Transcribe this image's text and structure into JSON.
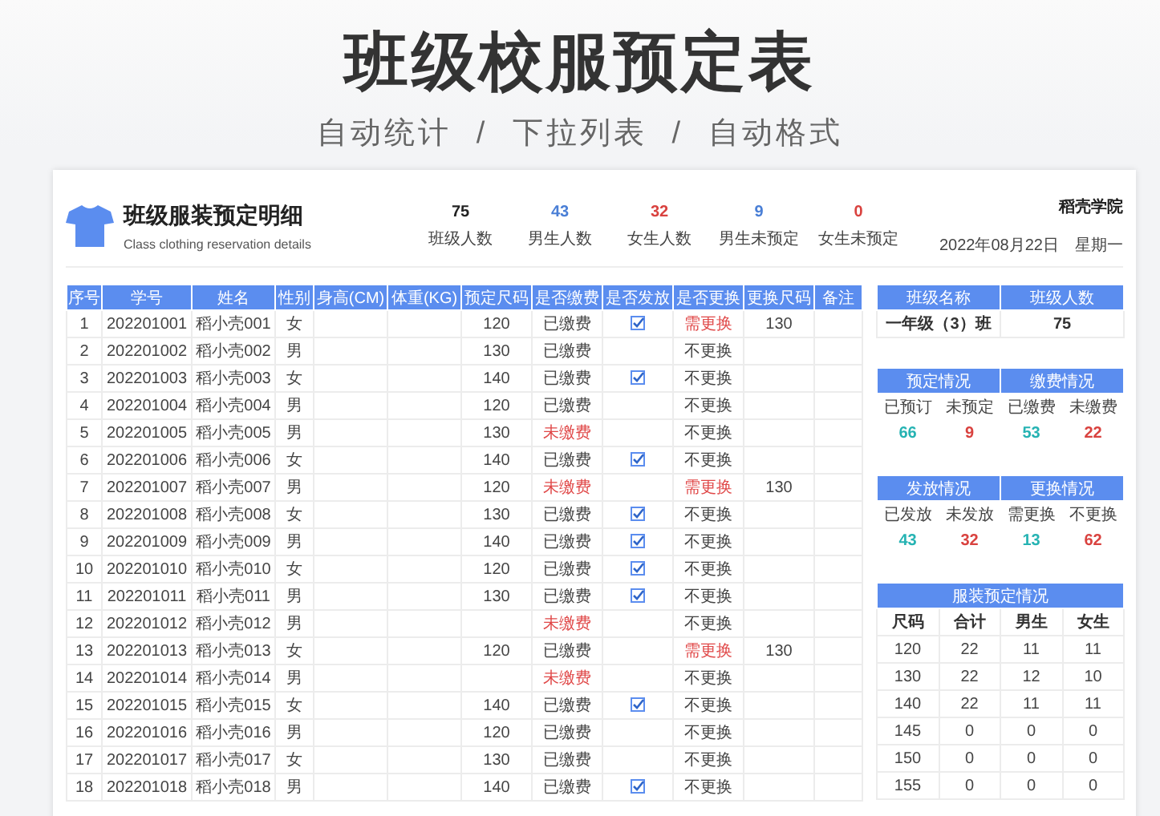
{
  "title": "班级校服预定表",
  "subtitle": "自动统计 / 下拉列表 / 自动格式",
  "card": {
    "title": "班级服装预定明细",
    "subtitle": "Class clothing reservation details",
    "school": "稻壳学院",
    "date": "2022年08月22日",
    "weekday": "星期一",
    "stats": [
      {
        "value": "75",
        "label": "班级人数",
        "color": "#222222"
      },
      {
        "value": "43",
        "label": "男生人数",
        "color": "#4a7fd6"
      },
      {
        "value": "32",
        "label": "女生人数",
        "color": "#d9423f"
      },
      {
        "value": "9",
        "label": "男生未预定",
        "color": "#4a7fd6"
      },
      {
        "value": "0",
        "label": "女生未预定",
        "color": "#d9423f"
      }
    ]
  },
  "table": {
    "columns": [
      "序号",
      "学号",
      "姓名",
      "性别",
      "身高(CM)",
      "体重(KG)",
      "预定尺码",
      "是否缴费",
      "是否发放",
      "是否更换",
      "更换尺码",
      "备注"
    ],
    "rows": [
      {
        "no": "1",
        "id": "202201001",
        "name": "稻小壳001",
        "gender": "女",
        "size": "120",
        "payment": "已缴费",
        "paid": true,
        "delivered": true,
        "exchange": "需更换",
        "exchange_needed": true,
        "new_size": "130"
      },
      {
        "no": "2",
        "id": "202201002",
        "name": "稻小壳002",
        "gender": "男",
        "size": "130",
        "payment": "已缴费",
        "paid": true,
        "delivered": false,
        "exchange": "不更换",
        "exchange_needed": false
      },
      {
        "no": "3",
        "id": "202201003",
        "name": "稻小壳003",
        "gender": "女",
        "size": "140",
        "payment": "已缴费",
        "paid": true,
        "delivered": true,
        "exchange": "不更换",
        "exchange_needed": false
      },
      {
        "no": "4",
        "id": "202201004",
        "name": "稻小壳004",
        "gender": "男",
        "size": "120",
        "payment": "已缴费",
        "paid": true,
        "delivered": false,
        "exchange": "不更换",
        "exchange_needed": false
      },
      {
        "no": "5",
        "id": "202201005",
        "name": "稻小壳005",
        "gender": "男",
        "size": "130",
        "payment": "未缴费",
        "paid": false,
        "delivered": false,
        "exchange": "不更换",
        "exchange_needed": false
      },
      {
        "no": "6",
        "id": "202201006",
        "name": "稻小壳006",
        "gender": "女",
        "size": "140",
        "payment": "已缴费",
        "paid": true,
        "delivered": true,
        "exchange": "不更换",
        "exchange_needed": false
      },
      {
        "no": "7",
        "id": "202201007",
        "name": "稻小壳007",
        "gender": "男",
        "size": "120",
        "payment": "未缴费",
        "paid": false,
        "delivered": false,
        "exchange": "需更换",
        "exchange_needed": true,
        "new_size": "130"
      },
      {
        "no": "8",
        "id": "202201008",
        "name": "稻小壳008",
        "gender": "女",
        "size": "130",
        "payment": "已缴费",
        "paid": true,
        "delivered": true,
        "exchange": "不更换",
        "exchange_needed": false
      },
      {
        "no": "9",
        "id": "202201009",
        "name": "稻小壳009",
        "gender": "男",
        "size": "140",
        "payment": "已缴费",
        "paid": true,
        "delivered": true,
        "exchange": "不更换",
        "exchange_needed": false
      },
      {
        "no": "10",
        "id": "202201010",
        "name": "稻小壳010",
        "gender": "女",
        "size": "120",
        "payment": "已缴费",
        "paid": true,
        "delivered": true,
        "exchange": "不更换",
        "exchange_needed": false
      },
      {
        "no": "11",
        "id": "202201011",
        "name": "稻小壳011",
        "gender": "男",
        "size": "130",
        "payment": "已缴费",
        "paid": true,
        "delivered": true,
        "exchange": "不更换",
        "exchange_needed": false
      },
      {
        "no": "12",
        "id": "202201012",
        "name": "稻小壳012",
        "gender": "男",
        "payment": "未缴费",
        "paid": false,
        "delivered": false,
        "exchange": "不更换",
        "exchange_needed": false
      },
      {
        "no": "13",
        "id": "202201013",
        "name": "稻小壳013",
        "gender": "女",
        "size": "120",
        "payment": "已缴费",
        "paid": true,
        "delivered": false,
        "exchange": "需更换",
        "exchange_needed": true,
        "new_size": "130"
      },
      {
        "no": "14",
        "id": "202201014",
        "name": "稻小壳014",
        "gender": "男",
        "payment": "未缴费",
        "paid": false,
        "delivered": false,
        "exchange": "不更换",
        "exchange_needed": false
      },
      {
        "no": "15",
        "id": "202201015",
        "name": "稻小壳015",
        "gender": "女",
        "size": "140",
        "payment": "已缴费",
        "paid": true,
        "delivered": true,
        "exchange": "不更换",
        "exchange_needed": false
      },
      {
        "no": "16",
        "id": "202201016",
        "name": "稻小壳016",
        "gender": "男",
        "size": "120",
        "payment": "已缴费",
        "paid": true,
        "delivered": false,
        "exchange": "不更换",
        "exchange_needed": false
      },
      {
        "no": "17",
        "id": "202201017",
        "name": "稻小壳017",
        "gender": "女",
        "size": "130",
        "payment": "已缴费",
        "paid": true,
        "delivered": false,
        "exchange": "不更换",
        "exchange_needed": false
      },
      {
        "no": "18",
        "id": "202201018",
        "name": "稻小壳018",
        "gender": "男",
        "size": "140",
        "payment": "已缴费",
        "paid": true,
        "delivered": true,
        "exchange": "不更换",
        "exchange_needed": false
      }
    ]
  },
  "class_info": {
    "columns": [
      "班级名称",
      "班级人数"
    ],
    "values": [
      "一年级（3）班",
      "75"
    ]
  },
  "panels": [
    {
      "title": "预定情况",
      "items": [
        {
          "label": "已预订",
          "value": "66",
          "color": "#26b3b3"
        },
        {
          "label": "未预定",
          "value": "9",
          "color": "#d9423f"
        }
      ]
    },
    {
      "title": "缴费情况",
      "items": [
        {
          "label": "已缴费",
          "value": "53",
          "color": "#26b3b3"
        },
        {
          "label": "未缴费",
          "value": "22",
          "color": "#d9423f"
        }
      ]
    },
    {
      "title": "发放情况",
      "items": [
        {
          "label": "已发放",
          "value": "43",
          "color": "#26b3b3"
        },
        {
          "label": "未发放",
          "value": "32",
          "color": "#d9423f"
        }
      ]
    },
    {
      "title": "更换情况",
      "items": [
        {
          "label": "需更换",
          "value": "13",
          "color": "#26b3b3"
        },
        {
          "label": "不更换",
          "value": "62",
          "color": "#d9423f"
        }
      ]
    }
  ],
  "size_table": {
    "title": "服装预定情况",
    "columns": [
      "尺码",
      "合计",
      "男生",
      "女生"
    ],
    "rows": [
      [
        "120",
        "22",
        "11",
        "11"
      ],
      [
        "130",
        "22",
        "12",
        "10"
      ],
      [
        "140",
        "22",
        "11",
        "11"
      ],
      [
        "145",
        "0",
        "0",
        "0"
      ],
      [
        "150",
        "0",
        "0",
        "0"
      ],
      [
        "155",
        "0",
        "0",
        "0"
      ]
    ]
  }
}
